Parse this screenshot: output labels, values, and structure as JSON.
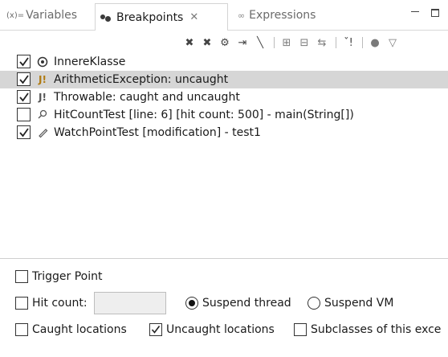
{
  "tabs": {
    "variables": {
      "prefix": "(x)=",
      "label": "Variables"
    },
    "breakpoints": {
      "label": "Breakpoints",
      "close": "✕"
    },
    "expressions": {
      "label": "Expressions"
    }
  },
  "toolbar": {
    "items": [
      "remove-icon",
      "remove-all-icon",
      "show-supported-icon",
      "goto-file-icon",
      "skip-all-icon",
      "expand-all-icon",
      "collapse-all-icon",
      "link-with-view-icon",
      "add-java-exception-icon",
      "breakpoint-types-icon",
      "view-menu-icon"
    ]
  },
  "breakpoints": [
    {
      "label": "InnereKlasse",
      "checked": true,
      "icon": "class-load-breakpoint-icon",
      "selected": false
    },
    {
      "label": "ArithmeticException: uncaught",
      "checked": true,
      "icon": "exception-breakpoint-icon",
      "selected": true
    },
    {
      "label": "Throwable: caught and uncaught",
      "checked": true,
      "icon": "exception-breakpoint-icon",
      "selected": false
    },
    {
      "label": "HitCountTest [line: 6] [hit count: 500] - main(String[])",
      "checked": false,
      "icon": "line-breakpoint-icon",
      "selected": false
    },
    {
      "label": "WatchPointTest [modification] - test1",
      "checked": true,
      "icon": "watchpoint-icon",
      "selected": false
    }
  ],
  "details": {
    "trigger_point": {
      "label": "Trigger Point",
      "checked": false
    },
    "hit_count": {
      "label": "Hit count:",
      "checked": false,
      "value": ""
    },
    "suspend_thread": {
      "label": "Suspend thread",
      "selected": true
    },
    "suspend_vm": {
      "label": "Suspend VM",
      "selected": false
    },
    "caught_locations": {
      "label": "Caught locations",
      "checked": false
    },
    "uncaught_locations": {
      "label": "Uncaught locations",
      "checked": true
    },
    "subclasses": {
      "label": "Subclasses of this exce",
      "checked": false
    }
  },
  "colors": {
    "selection": "#d6d6d6",
    "exception_icon": "#b07a10",
    "watch_icon": "#555555"
  }
}
